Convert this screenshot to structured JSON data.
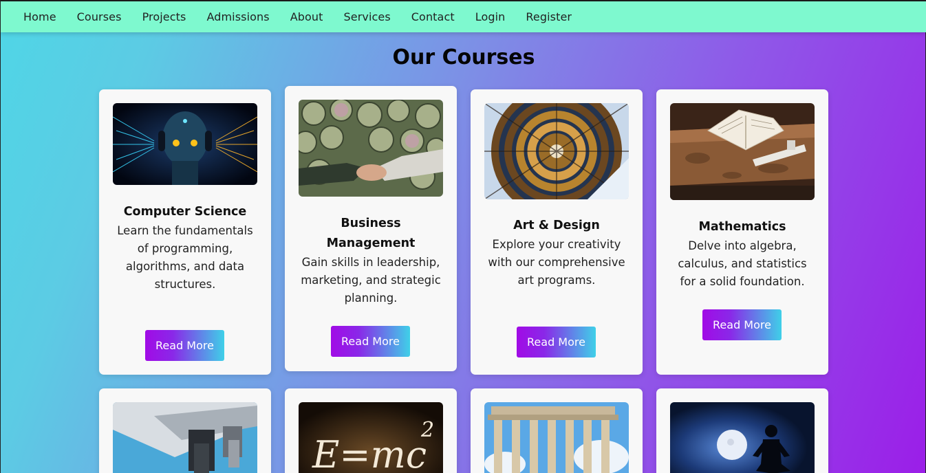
{
  "nav": {
    "items": [
      {
        "label": "Home"
      },
      {
        "label": "Courses"
      },
      {
        "label": "Projects"
      },
      {
        "label": "Admissions"
      },
      {
        "label": "About"
      },
      {
        "label": "Services"
      },
      {
        "label": "Contact"
      },
      {
        "label": "Login"
      },
      {
        "label": "Register"
      }
    ]
  },
  "page": {
    "title": "Our Courses"
  },
  "courses": [
    {
      "title": "Computer Science",
      "description": "Learn the fundamentals of programming, algorithms, and data structures.",
      "button": "Read More",
      "image": "robot-with-headphones-image"
    },
    {
      "title": "Business Management",
      "description": "Gain skills in leadership, marketing, and strategic planning.",
      "button": "Read More",
      "image": "handshake-over-clocks-image"
    },
    {
      "title": "Art & Design",
      "description": "Explore your creativity with our comprehensive art programs.",
      "button": "Read More",
      "image": "spiral-staircase-image"
    },
    {
      "title": "Mathematics",
      "description": "Delve into algebra, calculus, and statistics for a solid foundation.",
      "button": "Read More",
      "image": "book-and-slide-rule-image"
    }
  ],
  "course_images_row2": [
    {
      "image": "microscope-image"
    },
    {
      "image": "emc2-chalkboard-image"
    },
    {
      "image": "greek-temple-ruins-image"
    },
    {
      "image": "meditation-silhouette-moon-image"
    }
  ],
  "colors": {
    "navbar_bg": "#7ef9cf",
    "button_gradient_start": "#a10be6",
    "button_gradient_end": "#3fd0e8",
    "background_gradient_start": "#4fd6e6",
    "background_gradient_end": "#9b1ee8"
  }
}
